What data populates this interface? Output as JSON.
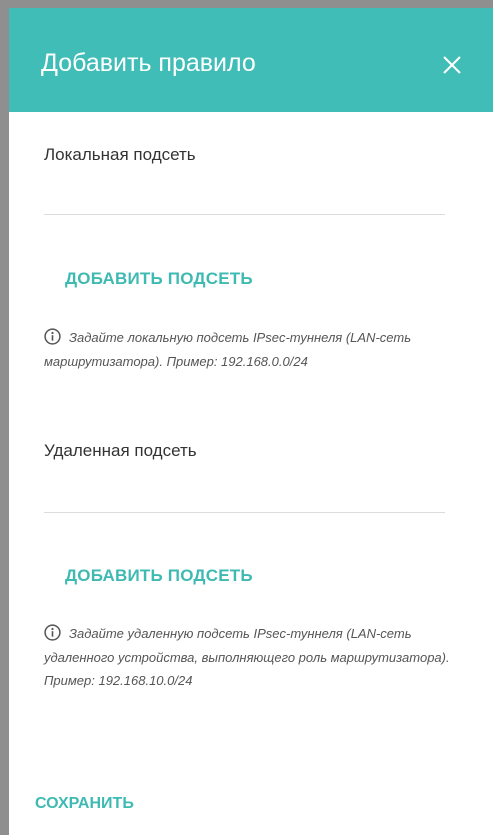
{
  "dialog": {
    "title": "Добавить правило",
    "close_icon": "close-icon"
  },
  "local": {
    "label": "Локальная подсеть",
    "value": "",
    "add_button": "ДОБАВИТЬ ПОДСЕТЬ",
    "hint": "Задайте локальную подсеть IPsec-туннеля (LAN-сеть маршрутизатора). Пример: 192.168.0.0/24"
  },
  "remote": {
    "label": "Удаленная подсеть",
    "value": "",
    "add_button": "ДОБАВИТЬ ПОДСЕТЬ",
    "hint": "Задайте удаленную подсеть IPsec-туннеля (LAN-сеть удаленного устройства, выполняющего роль маршрутизатора). Пример: 192.168.10.0/24"
  },
  "footer": {
    "save_button": "СОХРАНИТЬ"
  },
  "colors": {
    "accent": "#40bdb6",
    "button_text": "#3fbab3"
  }
}
